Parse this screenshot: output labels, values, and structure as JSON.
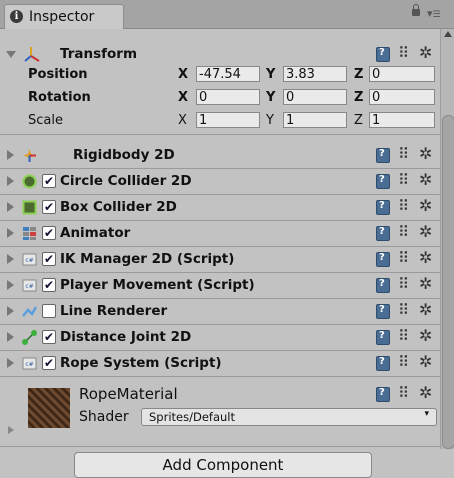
{
  "tab": {
    "title": "Inspector",
    "info_glyph": "i",
    "lock_icon": "lock-icon",
    "menu_icon": "tab-menu-icon"
  },
  "transform": {
    "title": "Transform",
    "rows": [
      {
        "label": "Position",
        "x_label": "X",
        "x": "-47.54",
        "y_label": "Y",
        "y": "3.83",
        "z_label": "Z",
        "z": "0"
      },
      {
        "label": "Rotation",
        "x_label": "X",
        "x": "0",
        "y_label": "Y",
        "y": "0",
        "z_label": "Z",
        "z": "0"
      },
      {
        "label": "Scale",
        "x_label": "X",
        "x": "1",
        "y_label": "Y",
        "y": "1",
        "z_label": "Z",
        "z": "1"
      }
    ]
  },
  "components": [
    {
      "name": "Rigidbody 2D",
      "icon": "rigidbody-icon",
      "has_checkbox": false
    },
    {
      "name": "Circle Collider 2D",
      "icon": "circle-collider-icon",
      "has_checkbox": true,
      "checked": "✔"
    },
    {
      "name": "Box Collider 2D",
      "icon": "box-collider-icon",
      "has_checkbox": true,
      "checked": "✔"
    },
    {
      "name": "Animator",
      "icon": "animator-icon",
      "has_checkbox": true,
      "checked": "✔"
    },
    {
      "name": "IK Manager 2D (Script)",
      "icon": "script-icon",
      "has_checkbox": true,
      "checked": "✔"
    },
    {
      "name": "Player Movement (Script)",
      "icon": "script-icon",
      "has_checkbox": true,
      "checked": "✔"
    },
    {
      "name": "Line Renderer",
      "icon": "line-renderer-icon",
      "has_checkbox": true,
      "checked": ""
    },
    {
      "name": "Distance Joint 2D",
      "icon": "distance-joint-icon",
      "has_checkbox": true,
      "checked": "✔"
    },
    {
      "name": "Rope System (Script)",
      "icon": "script-icon",
      "has_checkbox": true,
      "checked": "✔"
    }
  ],
  "material": {
    "name": "RopeMaterial",
    "shader_label": "Shader",
    "shader_value": "Sprites/Default",
    "dropdown_glyph": "▾"
  },
  "add_component_label": "Add Component",
  "glyphs": {
    "preset": "⠿",
    "gear": "✲",
    "script_tag": "c#"
  },
  "colors": {
    "panel": "#c2c2c2",
    "tab_bar": "#a4a4a4",
    "help_icon": "#4a6e93"
  }
}
